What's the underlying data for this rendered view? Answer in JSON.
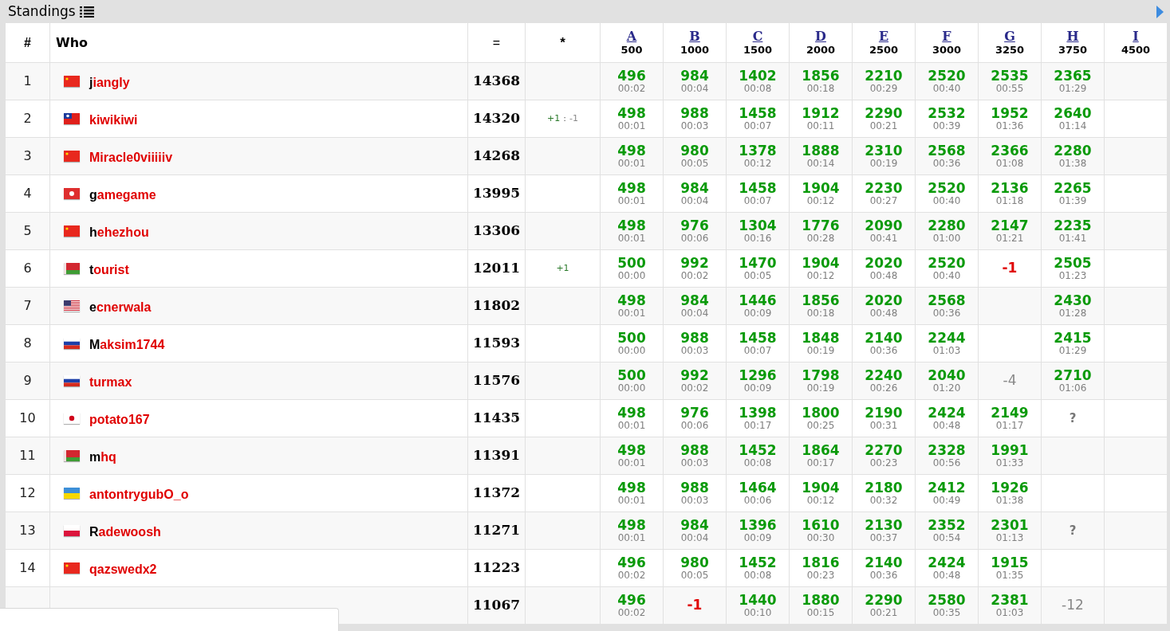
{
  "panel": {
    "title": "Standings"
  },
  "columns": {
    "rank": "#",
    "who": "Who",
    "score": "=",
    "hacks": "*"
  },
  "problems": [
    {
      "letter": "A",
      "points": "500"
    },
    {
      "letter": "B",
      "points": "1000"
    },
    {
      "letter": "C",
      "points": "1500"
    },
    {
      "letter": "D",
      "points": "2000"
    },
    {
      "letter": "E",
      "points": "2500"
    },
    {
      "letter": "F",
      "points": "3000"
    },
    {
      "letter": "G",
      "points": "3250"
    },
    {
      "letter": "H",
      "points": "3750"
    },
    {
      "letter": "I",
      "points": "4500"
    }
  ],
  "rows": [
    {
      "rank": "1",
      "flag": {
        "kind": "cn"
      },
      "handle": "jiangly",
      "legendary": true,
      "score": "14368",
      "cells": [
        {
          "kind": "ac",
          "points": "496",
          "time": "00:02"
        },
        {
          "kind": "ac",
          "points": "984",
          "time": "00:04"
        },
        {
          "kind": "ac",
          "points": "1402",
          "time": "00:08"
        },
        {
          "kind": "ac",
          "points": "1856",
          "time": "00:18"
        },
        {
          "kind": "ac",
          "points": "2210",
          "time": "00:29"
        },
        {
          "kind": "ac",
          "points": "2520",
          "time": "00:40"
        },
        {
          "kind": "ac",
          "points": "2535",
          "time": "00:55"
        },
        {
          "kind": "ac",
          "points": "2365",
          "time": "01:29"
        },
        {
          "kind": "empty"
        }
      ]
    },
    {
      "rank": "2",
      "flag": {
        "kind": "tw"
      },
      "handle": "kiwikiwi",
      "legendary": false,
      "score": "14320",
      "hacks": {
        "plus": "+1",
        "separator": ":",
        "minus": "-1"
      },
      "cells": [
        {
          "kind": "ac",
          "points": "498",
          "time": "00:01"
        },
        {
          "kind": "ac",
          "points": "988",
          "time": "00:03"
        },
        {
          "kind": "ac",
          "points": "1458",
          "time": "00:07"
        },
        {
          "kind": "ac",
          "points": "1912",
          "time": "00:11"
        },
        {
          "kind": "ac",
          "points": "2290",
          "time": "00:21"
        },
        {
          "kind": "ac",
          "points": "2532",
          "time": "00:39"
        },
        {
          "kind": "ac",
          "points": "1952",
          "time": "01:36"
        },
        {
          "kind": "ac",
          "points": "2640",
          "time": "01:14"
        },
        {
          "kind": "empty"
        }
      ]
    },
    {
      "rank": "3",
      "flag": {
        "kind": "cn"
      },
      "handle": "Miracle0viiiiiv",
      "legendary": false,
      "score": "14268",
      "cells": [
        {
          "kind": "ac",
          "points": "498",
          "time": "00:01"
        },
        {
          "kind": "ac",
          "points": "980",
          "time": "00:05"
        },
        {
          "kind": "ac",
          "points": "1378",
          "time": "00:12"
        },
        {
          "kind": "ac",
          "points": "1888",
          "time": "00:14"
        },
        {
          "kind": "ac",
          "points": "2310",
          "time": "00:19"
        },
        {
          "kind": "ac",
          "points": "2568",
          "time": "00:36"
        },
        {
          "kind": "ac",
          "points": "2366",
          "time": "01:08"
        },
        {
          "kind": "ac",
          "points": "2280",
          "time": "01:38"
        },
        {
          "kind": "empty"
        }
      ]
    },
    {
      "rank": "4",
      "flag": {
        "kind": "hk"
      },
      "handle": "gamegame",
      "legendary": true,
      "score": "13995",
      "cells": [
        {
          "kind": "ac",
          "points": "498",
          "time": "00:01"
        },
        {
          "kind": "ac",
          "points": "984",
          "time": "00:04"
        },
        {
          "kind": "ac",
          "points": "1458",
          "time": "00:07"
        },
        {
          "kind": "ac",
          "points": "1904",
          "time": "00:12"
        },
        {
          "kind": "ac",
          "points": "2230",
          "time": "00:27"
        },
        {
          "kind": "ac",
          "points": "2520",
          "time": "00:40"
        },
        {
          "kind": "ac",
          "points": "2136",
          "time": "01:18"
        },
        {
          "kind": "ac",
          "points": "2265",
          "time": "01:39"
        },
        {
          "kind": "empty"
        }
      ]
    },
    {
      "rank": "5",
      "flag": {
        "kind": "cn"
      },
      "handle": "hehezhou",
      "legendary": true,
      "score": "13306",
      "cells": [
        {
          "kind": "ac",
          "points": "498",
          "time": "00:01"
        },
        {
          "kind": "ac",
          "points": "976",
          "time": "00:06"
        },
        {
          "kind": "ac",
          "points": "1304",
          "time": "00:16"
        },
        {
          "kind": "ac",
          "points": "1776",
          "time": "00:28"
        },
        {
          "kind": "ac",
          "points": "2090",
          "time": "00:41"
        },
        {
          "kind": "ac",
          "points": "2280",
          "time": "01:00"
        },
        {
          "kind": "ac",
          "points": "2147",
          "time": "01:21"
        },
        {
          "kind": "ac",
          "points": "2235",
          "time": "01:41"
        },
        {
          "kind": "empty"
        }
      ]
    },
    {
      "rank": "6",
      "flag": {
        "kind": "by"
      },
      "handle": "tourist",
      "legendary": true,
      "score": "12011",
      "hacks": {
        "plus": "+1"
      },
      "cells": [
        {
          "kind": "ac",
          "points": "500",
          "time": "00:00"
        },
        {
          "kind": "ac",
          "points": "992",
          "time": "00:02"
        },
        {
          "kind": "ac",
          "points": "1470",
          "time": "00:05"
        },
        {
          "kind": "ac",
          "points": "1904",
          "time": "00:12"
        },
        {
          "kind": "ac",
          "points": "2020",
          "time": "00:48"
        },
        {
          "kind": "ac",
          "points": "2520",
          "time": "00:40"
        },
        {
          "kind": "rejected",
          "text": "-1"
        },
        {
          "kind": "ac",
          "points": "2505",
          "time": "01:23"
        },
        {
          "kind": "empty"
        }
      ]
    },
    {
      "rank": "7",
      "flag": {
        "kind": "us"
      },
      "handle": "ecnerwala",
      "legendary": true,
      "score": "11802",
      "cells": [
        {
          "kind": "ac",
          "points": "498",
          "time": "00:01"
        },
        {
          "kind": "ac",
          "points": "984",
          "time": "00:04"
        },
        {
          "kind": "ac",
          "points": "1446",
          "time": "00:09"
        },
        {
          "kind": "ac",
          "points": "1856",
          "time": "00:18"
        },
        {
          "kind": "ac",
          "points": "2020",
          "time": "00:48"
        },
        {
          "kind": "ac",
          "points": "2568",
          "time": "00:36"
        },
        {
          "kind": "empty"
        },
        {
          "kind": "ac",
          "points": "2430",
          "time": "01:28"
        },
        {
          "kind": "empty"
        }
      ]
    },
    {
      "rank": "8",
      "flag": {
        "kind": "ru"
      },
      "handle": "Maksim1744",
      "legendary": true,
      "score": "11593",
      "cells": [
        {
          "kind": "ac",
          "points": "500",
          "time": "00:00"
        },
        {
          "kind": "ac",
          "points": "988",
          "time": "00:03"
        },
        {
          "kind": "ac",
          "points": "1458",
          "time": "00:07"
        },
        {
          "kind": "ac",
          "points": "1848",
          "time": "00:19"
        },
        {
          "kind": "ac",
          "points": "2140",
          "time": "00:36"
        },
        {
          "kind": "ac",
          "points": "2244",
          "time": "01:03"
        },
        {
          "kind": "empty"
        },
        {
          "kind": "ac",
          "points": "2415",
          "time": "01:29"
        },
        {
          "kind": "empty"
        }
      ]
    },
    {
      "rank": "9",
      "flag": {
        "kind": "ru"
      },
      "handle": "turmax",
      "legendary": false,
      "score": "11576",
      "cells": [
        {
          "kind": "ac",
          "points": "500",
          "time": "00:00"
        },
        {
          "kind": "ac",
          "points": "992",
          "time": "00:02"
        },
        {
          "kind": "ac",
          "points": "1296",
          "time": "00:09"
        },
        {
          "kind": "ac",
          "points": "1798",
          "time": "00:19"
        },
        {
          "kind": "ac",
          "points": "2240",
          "time": "00:26"
        },
        {
          "kind": "ac",
          "points": "2040",
          "time": "01:20"
        },
        {
          "kind": "tried",
          "text": "-4"
        },
        {
          "kind": "ac",
          "points": "2710",
          "time": "01:06"
        },
        {
          "kind": "empty"
        }
      ]
    },
    {
      "rank": "10",
      "flag": {
        "kind": "jp"
      },
      "handle": "potato167",
      "legendary": false,
      "score": "11435",
      "cells": [
        {
          "kind": "ac",
          "points": "498",
          "time": "00:01"
        },
        {
          "kind": "ac",
          "points": "976",
          "time": "00:06"
        },
        {
          "kind": "ac",
          "points": "1398",
          "time": "00:17"
        },
        {
          "kind": "ac",
          "points": "1800",
          "time": "00:25"
        },
        {
          "kind": "ac",
          "points": "2190",
          "time": "00:31"
        },
        {
          "kind": "ac",
          "points": "2424",
          "time": "00:48"
        },
        {
          "kind": "ac",
          "points": "2149",
          "time": "01:17"
        },
        {
          "kind": "pending",
          "text": "?"
        },
        {
          "kind": "empty"
        }
      ]
    },
    {
      "rank": "11",
      "flag": {
        "kind": "by"
      },
      "handle": "mhq",
      "legendary": true,
      "score": "11391",
      "cells": [
        {
          "kind": "ac",
          "points": "498",
          "time": "00:01"
        },
        {
          "kind": "ac",
          "points": "988",
          "time": "00:03"
        },
        {
          "kind": "ac",
          "points": "1452",
          "time": "00:08"
        },
        {
          "kind": "ac",
          "points": "1864",
          "time": "00:17"
        },
        {
          "kind": "ac",
          "points": "2270",
          "time": "00:23"
        },
        {
          "kind": "ac",
          "points": "2328",
          "time": "00:56"
        },
        {
          "kind": "ac",
          "points": "1991",
          "time": "01:33"
        },
        {
          "kind": "empty"
        },
        {
          "kind": "empty"
        }
      ]
    },
    {
      "rank": "12",
      "flag": {
        "kind": "ua"
      },
      "handle": "antontrygubO_o",
      "legendary": false,
      "score": "11372",
      "cells": [
        {
          "kind": "ac",
          "points": "498",
          "time": "00:01"
        },
        {
          "kind": "ac",
          "points": "988",
          "time": "00:03"
        },
        {
          "kind": "ac",
          "points": "1464",
          "time": "00:06"
        },
        {
          "kind": "ac",
          "points": "1904",
          "time": "00:12"
        },
        {
          "kind": "ac",
          "points": "2180",
          "time": "00:32"
        },
        {
          "kind": "ac",
          "points": "2412",
          "time": "00:49"
        },
        {
          "kind": "ac",
          "points": "1926",
          "time": "01:38"
        },
        {
          "kind": "empty"
        },
        {
          "kind": "empty"
        }
      ]
    },
    {
      "rank": "13",
      "flag": {
        "kind": "pl"
      },
      "handle": "Radewoosh",
      "legendary": true,
      "score": "11271",
      "cells": [
        {
          "kind": "ac",
          "points": "498",
          "time": "00:01"
        },
        {
          "kind": "ac",
          "points": "984",
          "time": "00:04"
        },
        {
          "kind": "ac",
          "points": "1396",
          "time": "00:09"
        },
        {
          "kind": "ac",
          "points": "1610",
          "time": "00:30"
        },
        {
          "kind": "ac",
          "points": "2130",
          "time": "00:37"
        },
        {
          "kind": "ac",
          "points": "2352",
          "time": "00:54"
        },
        {
          "kind": "ac",
          "points": "2301",
          "time": "01:13"
        },
        {
          "kind": "pending",
          "text": "?"
        },
        {
          "kind": "empty"
        }
      ]
    },
    {
      "rank": "14",
      "flag": {
        "kind": "cn"
      },
      "handle": "qazswedx2",
      "legendary": false,
      "score": "11223",
      "cells": [
        {
          "kind": "ac",
          "points": "496",
          "time": "00:02"
        },
        {
          "kind": "ac",
          "points": "980",
          "time": "00:05"
        },
        {
          "kind": "ac",
          "points": "1452",
          "time": "00:08"
        },
        {
          "kind": "ac",
          "points": "1816",
          "time": "00:23"
        },
        {
          "kind": "ac",
          "points": "2140",
          "time": "00:36"
        },
        {
          "kind": "ac",
          "points": "2424",
          "time": "00:48"
        },
        {
          "kind": "ac",
          "points": "1915",
          "time": "01:35"
        },
        {
          "kind": "empty"
        },
        {
          "kind": "empty"
        }
      ]
    },
    {
      "score": "11067",
      "cells": [
        {
          "kind": "ac",
          "points": "496",
          "time": "00:02"
        },
        {
          "kind": "rejected",
          "text": "-1"
        },
        {
          "kind": "ac",
          "points": "1440",
          "time": "00:10"
        },
        {
          "kind": "ac",
          "points": "1880",
          "time": "00:15"
        },
        {
          "kind": "ac",
          "points": "2290",
          "time": "00:21"
        },
        {
          "kind": "ac",
          "points": "2580",
          "time": "00:35"
        },
        {
          "kind": "ac",
          "points": "2381",
          "time": "01:03"
        },
        {
          "kind": "tried",
          "text": "-12"
        },
        {
          "kind": "empty"
        }
      ]
    }
  ]
}
